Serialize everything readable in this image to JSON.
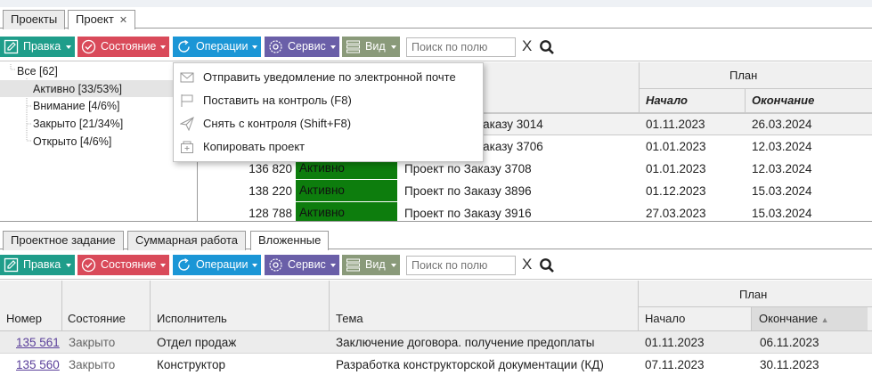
{
  "top_tabs": [
    {
      "label": "Проекты"
    },
    {
      "label": "Проект",
      "close": "✕"
    }
  ],
  "toolbar": {
    "edit": "Правка",
    "state": "Состояние",
    "operations": "Операции",
    "service": "Сервис",
    "view": "Вид",
    "search_placeholder": "Поиск по полю",
    "clear": "X"
  },
  "tree": {
    "root": "Все [62]",
    "items": [
      "Активно [33/53%]",
      "Внимание [4/6%]",
      "Закрыто [21/34%]",
      "Открыто [4/6%]"
    ]
  },
  "ops_menu": [
    {
      "label": "Отправить уведомление по электронной почте",
      "icon": "envelope-icon"
    },
    {
      "label": "Поставить на контроль (F8)",
      "icon": "flag-icon"
    },
    {
      "label": "Снять с контроля (Shift+F8)",
      "icon": "paper-plane-icon"
    },
    {
      "label": "Копировать проект",
      "icon": "copy-project-icon"
    }
  ],
  "upper_grid": {
    "group_header": "План",
    "col_start": "Начало",
    "col_end": "Окончание",
    "rows": [
      {
        "num": "",
        "status": "",
        "topic": "Заказу 3014",
        "start": "01.11.2023",
        "end": "26.03.2024"
      },
      {
        "num": "",
        "status": "",
        "topic": "Заказу 3706",
        "start": "01.01.2023",
        "end": "12.03.2024"
      },
      {
        "num": "136 820",
        "status": "Активно",
        "topic": "Проект по Заказу 3708",
        "start": "01.01.2023",
        "end": "12.03.2024"
      },
      {
        "num": "138 220",
        "status": "Активно",
        "topic": "Проект по Заказу 3896",
        "start": "01.12.2023",
        "end": "15.03.2024"
      },
      {
        "num": "128 788",
        "status": "Активно",
        "topic": "Проект по Заказу 3916",
        "start": "27.03.2023",
        "end": "15.03.2024"
      }
    ]
  },
  "bottom_tabs": [
    {
      "label": "Проектное задание"
    },
    {
      "label": "Суммарная работа"
    },
    {
      "label": "Вложенные"
    }
  ],
  "lower_grid": {
    "group_header": "План",
    "columns": [
      "Номер",
      "Состояние",
      "Исполнитель",
      "Тема",
      "Начало",
      "Окончание"
    ],
    "rows": [
      {
        "num": "135 561",
        "state": "Закрыто",
        "executor": "Отдел продаж",
        "topic": "Заключение договора. получение предоплаты",
        "start": "01.11.2023",
        "end": "06.11.2023"
      },
      {
        "num": "135 560",
        "state": "Закрыто",
        "executor": "Конструктор",
        "topic": "Разработка конструкторской документации (КД)",
        "start": "07.11.2023",
        "end": "30.11.2023"
      }
    ]
  },
  "colors": {
    "edit": "#1f9d8a",
    "state": "#d94a5a",
    "operations": "#1b96d6",
    "service": "#6a5fa8",
    "view": "#8a9a7a",
    "status_active": "#0d7d0d"
  }
}
